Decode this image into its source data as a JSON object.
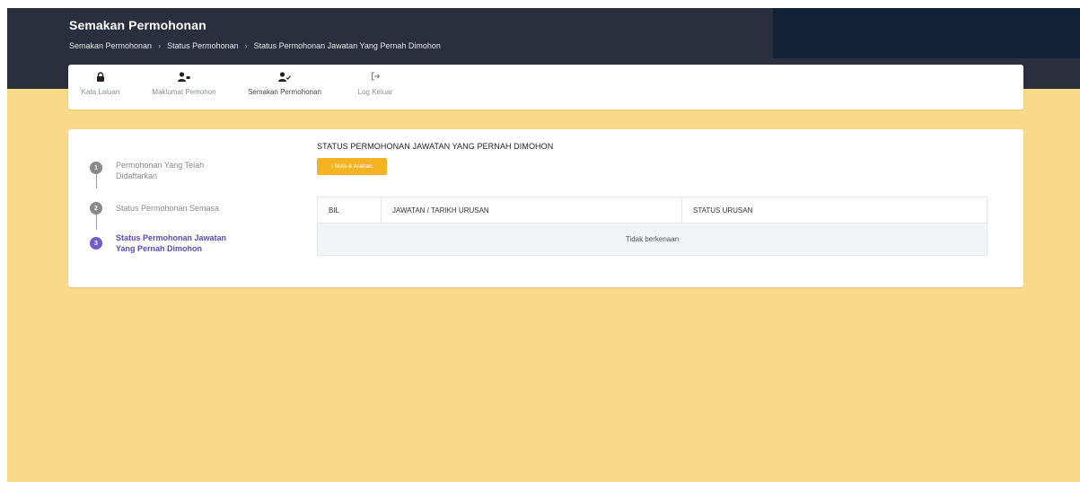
{
  "header": {
    "title": "Semakan Permohonan",
    "breadcrumb": [
      "Semakan Permohonan",
      "Status Permohonan",
      "Status Permohonan Jawatan Yang Pernah Dimohon"
    ]
  },
  "menu": {
    "items": [
      {
        "label": "Kata Laluan",
        "icon": "lock-icon"
      },
      {
        "label": "Maklumat Pemohon",
        "icon": "user-card-icon"
      },
      {
        "label": "Semakan Permohonan",
        "icon": "user-check-icon"
      },
      {
        "label": "Log Keluar",
        "icon": "logout-icon"
      }
    ]
  },
  "steps": [
    {
      "number": "1",
      "label": "Permohonan Yang Telah Didaftarkan",
      "active": false
    },
    {
      "number": "2",
      "label": "Status Permohonan Semasa",
      "active": false
    },
    {
      "number": "3",
      "label": "Status Permohonan Jawatan Yang Pernah Dimohon",
      "active": true
    }
  ],
  "section": {
    "title": "STATUS PERMOHONAN JAWATAN YANG PERNAH DIMOHON",
    "nota_button": "i Nota & Arahan"
  },
  "table": {
    "headers": [
      "BIL",
      "JAWATAN / TARIKH URUSAN",
      "STATUS URUSAN"
    ],
    "empty_message": "Tidak berkenaan"
  },
  "colors": {
    "header_bg": "#2b2f3d",
    "page_bg": "#f9d98a",
    "accent_button": "#f5b323",
    "step_inactive": "#8a8a8a",
    "step_active": "#6f5bc9"
  }
}
